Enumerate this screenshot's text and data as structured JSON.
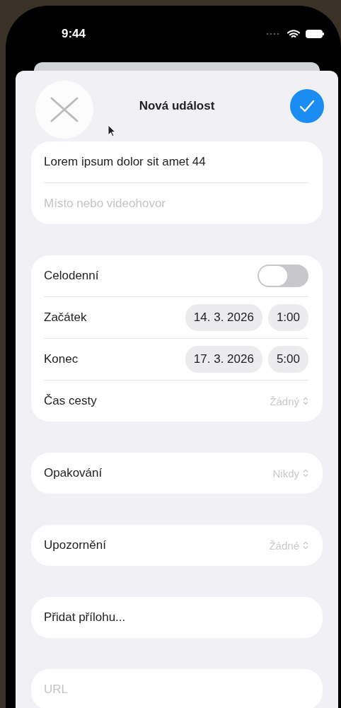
{
  "status_bar": {
    "time": "9:44"
  },
  "header": {
    "title": "Nová událost"
  },
  "details": {
    "title": "Lorem ipsum dolor sit amet 44",
    "location_placeholder": "Místo nebo videohovor"
  },
  "schedule": {
    "all_day": {
      "label": "Celodenní",
      "on": false
    },
    "start": {
      "label": "Začátek",
      "date": "14. 3. 2026",
      "time": "1:00"
    },
    "end": {
      "label": "Konec",
      "date": "17. 3. 2026",
      "time": "5:00"
    },
    "travel_time": {
      "label": "Čas cesty",
      "value": "Žádný"
    }
  },
  "repeat": {
    "label": "Opakování",
    "value": "Nikdy"
  },
  "alert": {
    "label": "Upozornění",
    "value": "Žádné"
  },
  "attachment": {
    "label": "Přidat přílohu..."
  },
  "url": {
    "placeholder": "URL"
  }
}
